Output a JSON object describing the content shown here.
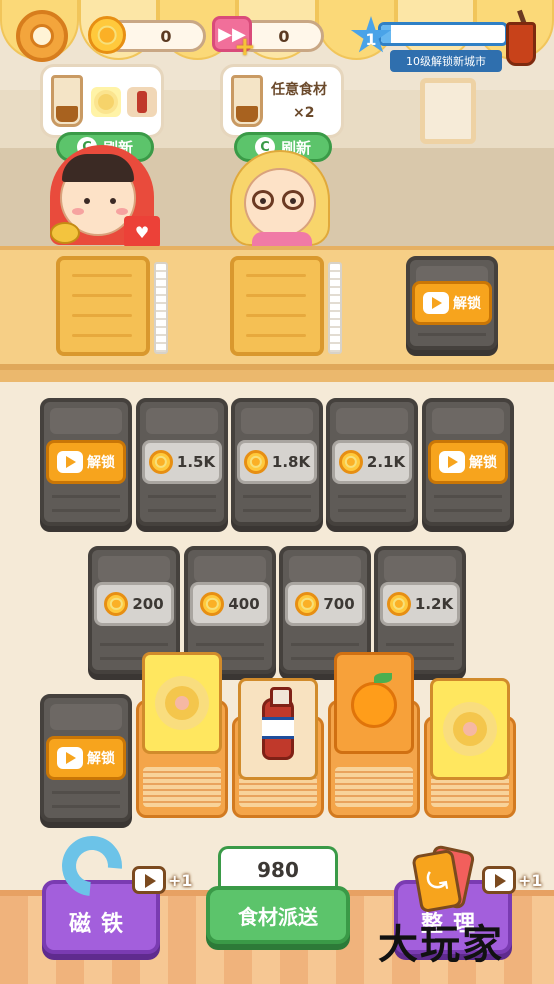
{
  "hud": {
    "coins": "0",
    "skips": "0",
    "level": "1",
    "level_progress": 0.08,
    "level_caption": "10级解锁新城市",
    "skip_icon_glyph": "▶▶",
    "skip_plus_glyph": "+"
  },
  "orders": [
    {
      "items": [
        "milk-tea",
        "flower",
        "bottle"
      ],
      "refresh_label": "刷新"
    },
    {
      "text": "任意食材",
      "multiplier": "×2",
      "refresh_label": "刷新"
    }
  ],
  "icons": {
    "refresh": "C",
    "heart": "♥"
  },
  "trays": [
    {
      "state": "empty"
    },
    {
      "state": "empty"
    },
    {
      "state": "locked",
      "label": "解锁"
    }
  ],
  "board": {
    "row1": [
      {
        "kind": "ad-unlock",
        "label": "解锁"
      },
      {
        "kind": "price",
        "label": "1.5K"
      },
      {
        "kind": "price",
        "label": "1.8K"
      },
      {
        "kind": "price",
        "label": "2.1K"
      },
      {
        "kind": "ad-unlock",
        "label": "解锁"
      }
    ],
    "row2": [
      {
        "kind": "price",
        "label": "200"
      },
      {
        "kind": "price",
        "label": "400"
      },
      {
        "kind": "price",
        "label": "700"
      },
      {
        "kind": "price",
        "label": "1.2K"
      }
    ],
    "row3": [
      {
        "kind": "ad-unlock",
        "label": "解锁"
      },
      {
        "kind": "card",
        "item": "flower"
      },
      {
        "kind": "card",
        "item": "bottle"
      },
      {
        "kind": "card",
        "item": "orange"
      },
      {
        "kind": "card",
        "item": "flower"
      }
    ]
  },
  "bottom": {
    "magnet_label": "磁铁",
    "magnet_bonus": "+1",
    "count": "980",
    "send_label": "食材派送",
    "sort_label": "整理",
    "sort_bonus": "+1",
    "sort_card_glyph": "⤿"
  },
  "watermark": "大玩家",
  "colors": {
    "accent_green": "#5cc46b",
    "unlock_orange": "#f7a41d",
    "purple": "#a35fdc",
    "level_blue": "#2f80c6"
  }
}
